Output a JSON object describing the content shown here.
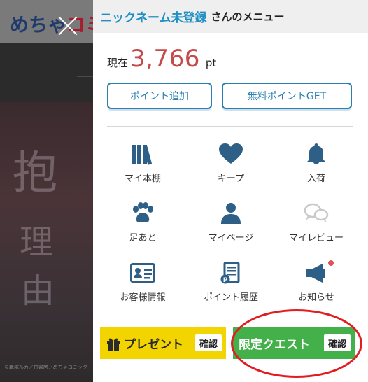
{
  "background": {
    "logo_part1": "めちゃ",
    "logo_part2": "コミック",
    "art_text_1": "抱",
    "art_text_2": "理",
    "art_text_3": "由",
    "caption": "©鷹塚ルカ／竹書房／めちゃコミック"
  },
  "panel": {
    "nickname": "ニックネーム未登録",
    "menu_suffix": "さんのメニュー",
    "points_label": "現在",
    "points_value": "3,766",
    "points_unit": "pt",
    "add_points_label": "ポイント追加",
    "free_points_label": "無料ポイントGET"
  },
  "menu": {
    "items": [
      {
        "label": "マイ本棚",
        "icon": "bookshelf-icon"
      },
      {
        "label": "キープ",
        "icon": "heart-icon"
      },
      {
        "label": "入荷",
        "icon": "bell-icon"
      },
      {
        "label": "足あと",
        "icon": "paw-icon"
      },
      {
        "label": "マイページ",
        "icon": "user-icon"
      },
      {
        "label": "マイレビュー",
        "icon": "chat-bubbles-icon"
      },
      {
        "label": "お客様情報",
        "icon": "id-card-icon"
      },
      {
        "label": "ポイント履歴",
        "icon": "receipt-icon"
      },
      {
        "label": "お知らせ",
        "icon": "megaphone-icon"
      }
    ]
  },
  "banners": {
    "present_title": "プレゼント",
    "present_confirm": "確認",
    "quest_title": "限定クエスト",
    "quest_confirm": "確認"
  },
  "colors": {
    "accent": "#1f8fc4",
    "points": "#c54b4b",
    "icon": "#2e5f86",
    "present": "#f2d400",
    "quest": "#44b04a",
    "highlight": "#e11d22"
  }
}
